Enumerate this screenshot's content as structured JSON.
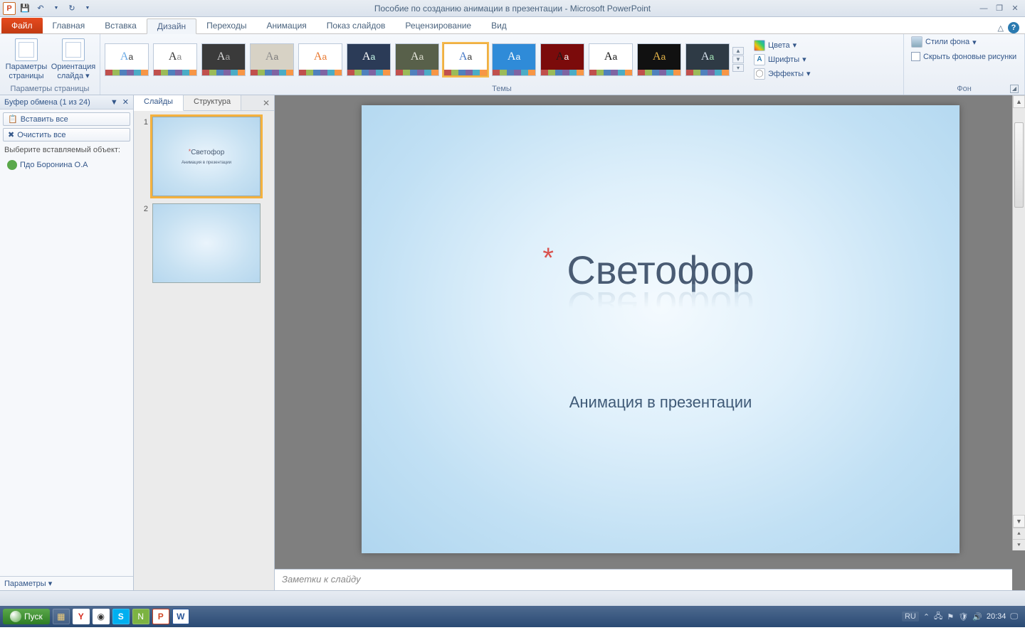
{
  "title": "Пособие по созданию анимации в презентации  -  Microsoft PowerPoint",
  "tabs": {
    "file": "Файл",
    "items": [
      "Главная",
      "Вставка",
      "Дизайн",
      "Переходы",
      "Анимация",
      "Показ слайдов",
      "Рецензирование",
      "Вид"
    ],
    "active_index": 2
  },
  "ribbon": {
    "page_setup": {
      "params": "Параметры страницы",
      "orient": "Ориентация слайда",
      "group": "Параметры страницы"
    },
    "themes_group": "Темы",
    "colors": "Цвета",
    "fonts": "Шрифты",
    "effects": "Эффекты",
    "bg_styles": "Стили фона",
    "hide_bg": "Скрыть фоновые рисунки",
    "bg_group": "Фон"
  },
  "themes": [
    {
      "bg": "#ffffff",
      "fg": "#6aa9e4",
      "sub": "#333"
    },
    {
      "bg": "#ffffff",
      "fg": "#333333",
      "sub": "#888"
    },
    {
      "bg": "#3a3a3a",
      "fg": "#dcdcdc",
      "sub": "#aaa"
    },
    {
      "bg": "#d7d2c5",
      "fg": "#8a8a8a",
      "sub": "#777"
    },
    {
      "bg": "#ffffff",
      "fg": "#e8762c",
      "sub": "#e8762c"
    },
    {
      "bg": "#2b3b57",
      "fg": "#ffffff",
      "sub": "#cfe"
    },
    {
      "bg": "#58604a",
      "fg": "#e9e9df",
      "sub": "#dedecf"
    },
    {
      "bg": "#ffffff",
      "fg": "#4679c7",
      "sub": "#333",
      "selected": true
    },
    {
      "bg": "#2f8bd8",
      "fg": "#ffffff",
      "sub": "#fff"
    },
    {
      "bg": "#7b0b0b",
      "fg": "#1a1a1a",
      "sub": "#fff"
    },
    {
      "bg": "#ffffff",
      "fg": "#111111",
      "sub": "#111"
    },
    {
      "bg": "#111111",
      "fg": "#e8b74a",
      "sub": "#e8b74a"
    },
    {
      "bg": "#2e3a45",
      "fg": "#d7e1ec",
      "sub": "#aeb"
    }
  ],
  "theme_strip": [
    "#c0504d",
    "#9bbb59",
    "#4f81bd",
    "#8064a2",
    "#4bacc6",
    "#f79646"
  ],
  "clipboard": {
    "title": "Буфер обмена (1 из 24)",
    "paste_all": "Вставить все",
    "clear_all": "Очистить все",
    "choose": "Выберите вставляемый объект:",
    "item": "Пдо Боронина О.А",
    "params": "Параметры"
  },
  "pane_tabs": {
    "slides": "Слайды",
    "outline": "Структура"
  },
  "thumbs": [
    {
      "num": "1",
      "title": "Светофор",
      "sub": "Анимация в презентации",
      "selected": true
    },
    {
      "num": "2",
      "title": "",
      "sub": ""
    }
  ],
  "slide": {
    "title": "Светофор",
    "subtitle": "Анимация в презентации"
  },
  "notes_placeholder": "Заметки к слайду",
  "taskbar": {
    "start": "Пуск",
    "lang": "RU",
    "time": "20:34"
  }
}
